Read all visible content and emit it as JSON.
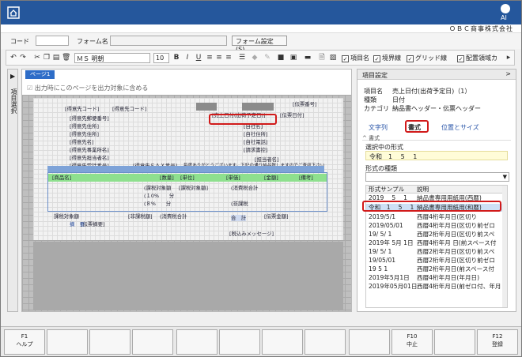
{
  "window": {
    "company": "ＯＢＣ商事株式会社",
    "logo_text": "AI"
  },
  "form": {
    "code_label": "コード",
    "name_label": "フォーム名",
    "settings_button": "フォーム設定(S)..."
  },
  "toolbar": {
    "font_name": "ＭＳ 明朝",
    "font_size": "10",
    "bold": "B",
    "italic": "I",
    "underline": "U",
    "checks": [
      {
        "label": "項目名",
        "checked": true
      },
      {
        "label": "境界線",
        "checked": true
      },
      {
        "label": "グリッド線",
        "checked": true
      },
      {
        "label": "配置領域カ",
        "checked": true
      }
    ],
    "more": "▸"
  },
  "left_tab": {
    "label": "項目選択",
    "arrow": "▶"
  },
  "canvas": {
    "page_tab": "ページ1",
    "output_option": "出力時にこのページを出力対象に含める",
    "fields": [
      "[得意先コード]",
      "[得意先コード]",
      "[伝票番号]",
      "[伝票日付]",
      "[得意先郵便番号]",
      "[得意先住所]",
      "[得意先住所]",
      "[得意先名]",
      "[得意先事業所名]",
      "[得意先担当者名]",
      "[得意先電話番号]",
      "[得意先ＦＡＸ番号]",
      "[売上日付(出荷予定日)]",
      "[自社名]",
      "[自社住所]",
      "[自社電話]",
      "[請求書控]",
      "[担当者名]",
      "毎度ありがとうございます。下記の通り納品致しますのでご査収下さい",
      "[商品名]",
      "[数量]",
      "[単位]",
      "[単価]",
      "[金額]",
      "[備考]",
      "(課税対象額",
      "[課税対象額]",
      "(消費税合計",
      "(１0%　　分",
      "(８%　　分",
      "(非課税",
      "課税対象額",
      "[非課税額]",
      "(消費税合計",
      "[伝票金額]",
      "[伝票摘要]",
      "合　計",
      "摘　要",
      "[税込みメッセージ]"
    ]
  },
  "panel": {
    "header": "項目設定",
    "info": [
      {
        "key": "項目名",
        "value": "売上日付(出荷予定日)（1）"
      },
      {
        "key": "種類",
        "value": "日付"
      },
      {
        "key": "カテゴリ",
        "value": "納品書ヘッダー・伝票ヘッダー"
      }
    ],
    "tabs": [
      "文字列",
      "書式",
      "位置とサイズ"
    ],
    "section": "^ 書式",
    "current_format_label": "選択中の形式",
    "current_format": "令和　1　 5　 1",
    "kind_label": "形式の種類",
    "table_headers": [
      "形式サンプル",
      "説明"
    ],
    "rows": [
      {
        "sample": "2019　 5　 1",
        "desc": "納品書専用用紙用(西暦)"
      },
      {
        "sample": "令和　1　 5　 1",
        "desc": "納品書専用用紙用(和暦)"
      },
      {
        "sample": "2019/5/1",
        "desc": "西暦4桁年月日(区切り"
      },
      {
        "sample": "2019/05/01",
        "desc": "西暦4桁年月日(区切り前ゼロ"
      },
      {
        "sample": "19/ 5/ 1",
        "desc": "西暦2桁年月日(区切り前スペ"
      },
      {
        "sample": "2019年 5月 1日",
        "desc": "西暦4桁年月 日(前スペース付"
      },
      {
        "sample": "19/ 5/ 1",
        "desc": "西暦2桁年月日(区切り前スペ"
      },
      {
        "sample": "19/05/01",
        "desc": "西暦2桁年月日(区切り前ゼロ"
      },
      {
        "sample": "19 5 1",
        "desc": "西暦2桁年月日(前スペース付"
      },
      {
        "sample": "2019年5月1日",
        "desc": "西暦4桁年月日(年月日)"
      },
      {
        "sample": "2019年05月01日",
        "desc": "西暦4桁年月日(前ゼロ付、年月"
      }
    ]
  },
  "fkeys": [
    {
      "key": "F1",
      "label": "ヘルプ"
    },
    {
      "key": "",
      "label": ""
    },
    {
      "key": "",
      "label": ""
    },
    {
      "key": "",
      "label": ""
    },
    {
      "key": "",
      "label": ""
    },
    {
      "key": "",
      "label": ""
    },
    {
      "key": "",
      "label": ""
    },
    {
      "key": "",
      "label": ""
    },
    {
      "key": "",
      "label": ""
    },
    {
      "key": "F10",
      "label": "中止"
    },
    {
      "key": "",
      "label": ""
    },
    {
      "key": "F12",
      "label": "登録"
    }
  ]
}
